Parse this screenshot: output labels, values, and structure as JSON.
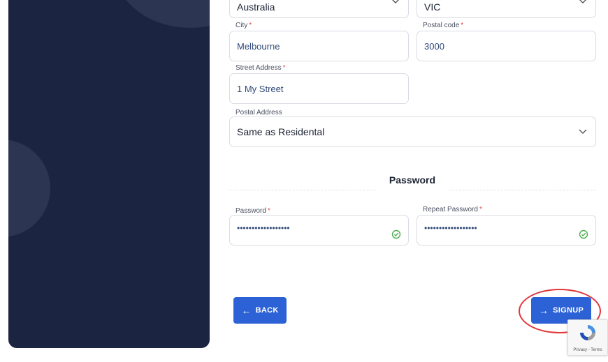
{
  "address": {
    "country": {
      "value": "Australia"
    },
    "state": {
      "value": "VIC"
    },
    "city": {
      "label": "City",
      "value": "Melbourne"
    },
    "postal_code": {
      "label": "Postal code",
      "value": "3000"
    },
    "street": {
      "label": "Street Address",
      "value": "1 My Street"
    },
    "postal_address": {
      "label": "Postal Address",
      "value": "Same as Residental"
    }
  },
  "password_section": {
    "title": "Password",
    "password": {
      "label": "Password",
      "value": "••••••••••••••••••"
    },
    "repeat": {
      "label": "Repeat Password",
      "value": "••••••••••••••••••"
    }
  },
  "required_marker": "*",
  "buttons": {
    "back": "BACK",
    "signup": "SIGNUP"
  },
  "recaptcha": {
    "text": "Privacy - Terms"
  },
  "colors": {
    "panel": "#1b2440",
    "primary": "#2d62d6",
    "required": "#e0474c",
    "valid": "#4caf50",
    "annotation": "#e0363a"
  },
  "icons": {
    "back": "arrow-left-icon",
    "signup": "arrow-right-icon",
    "valid": "check-circle-icon",
    "dropdown": "chevron-down-icon"
  }
}
